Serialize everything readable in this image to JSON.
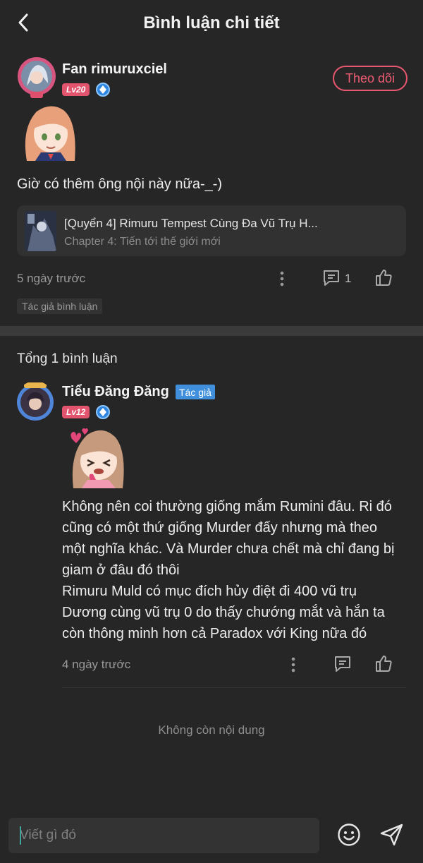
{
  "header": {
    "title": "Bình luận chi tiết"
  },
  "main_comment": {
    "username": "Fan rimuruxciel",
    "level": "Lv20",
    "follow_label": "Theo dõi",
    "text": "Giờ có thêm ông nội này nữa-_-)",
    "book": {
      "title": "[Quyển 4] Rimuru Tempest Cùng Đa Vũ Trụ H...",
      "chapter": "Chapter 4: Tiến tới thế giới mới"
    },
    "time": "5 ngày trước",
    "reply_count": "1",
    "tag": "Tác giả bình luận"
  },
  "replies_section": {
    "total_label": "Tổng 1 bình luận",
    "replies": [
      {
        "username": "Tiểu Đăng Đăng",
        "badge": "Tác giả",
        "level": "Lv12",
        "lines": [
          "Không nên coi thường giống mắm Rumini đâu. Ri đó",
          "cũng có một thứ giống Murder đấy nhưng mà theo",
          "một nghĩa khác. Và Murder chưa chết mà chỉ đang bị",
          "giam ở đâu đó thôi",
          "Rimuru Muld có mục đích hủy điệt đi 400 vũ trụ",
          "Dương cùng vũ trụ 0 do thấy chướng mắt và hắn ta",
          "còn thông minh hơn cả Paradox với King nữa đó"
        ],
        "time": "4 ngày trước"
      }
    ],
    "end_label": "Không còn nội dung"
  },
  "input": {
    "placeholder": "Viết gì đó"
  },
  "colors": {
    "accent_pink": "#e9566f",
    "author_blue": "#3f8fdc",
    "background": "#262626"
  }
}
